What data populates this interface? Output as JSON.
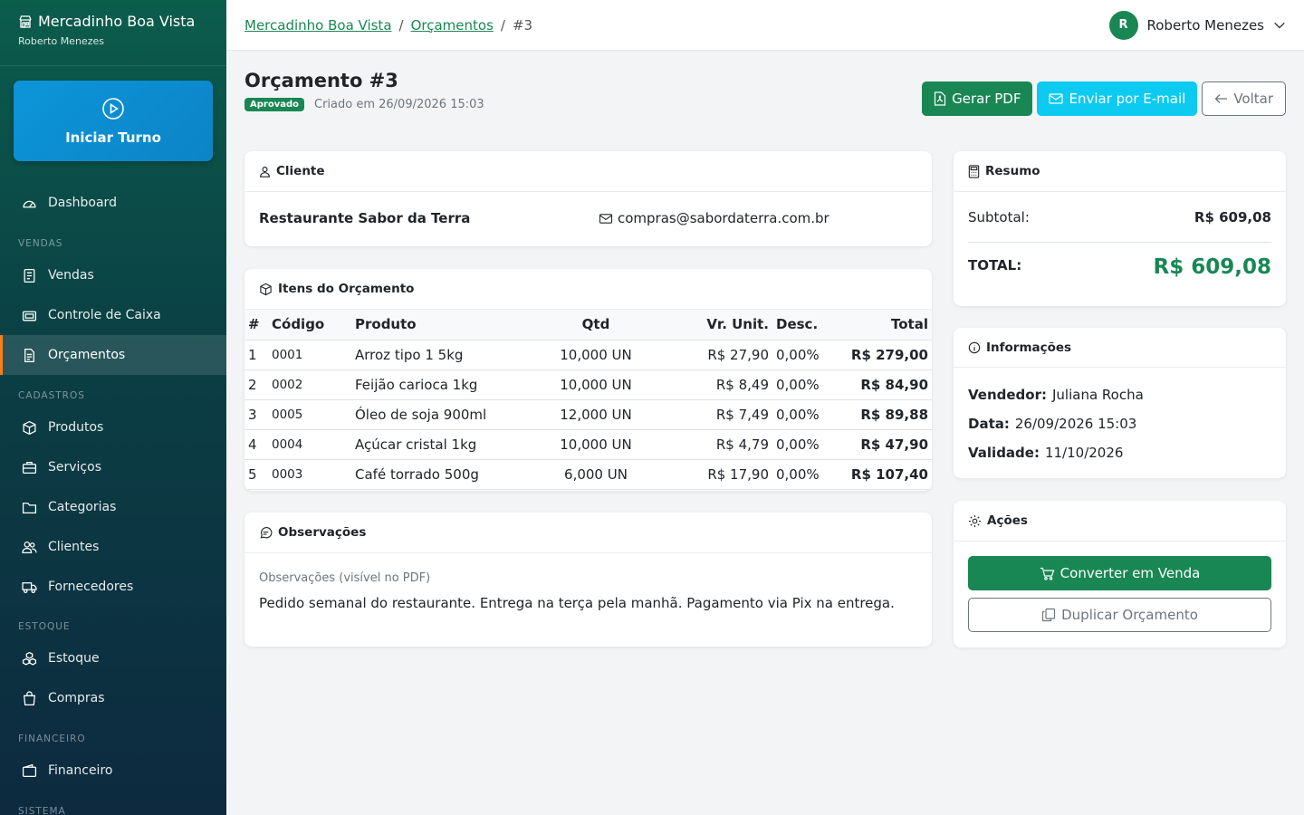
{
  "sidebar": {
    "brand_title": "Mercadinho Boa Vista",
    "brand_user": "Roberto Menezes",
    "shift_button": "Iniciar Turno",
    "dashboard": "Dashboard",
    "sections": {
      "vendas": "VENDAS",
      "cadastros": "CADASTROS",
      "estoque": "ESTOQUE",
      "financeiro": "FINANCEIRO",
      "sistema": "SISTEMA"
    },
    "items": {
      "vendas": "Vendas",
      "caixa": "Controle de Caixa",
      "orcamentos": "Orçamentos",
      "produtos": "Produtos",
      "servicos": "Serviços",
      "categorias": "Categorias",
      "clientes": "Clientes",
      "fornecedores": "Fornecedores",
      "estoque": "Estoque",
      "compras": "Compras",
      "financeiro": "Financeiro"
    }
  },
  "topbar": {
    "breadcrumb": [
      "Mercadinho Boa Vista",
      "Orçamentos",
      "#3"
    ],
    "separator": "/",
    "user_initial": "R",
    "user_name": "Roberto Menezes"
  },
  "header": {
    "title": "Orçamento #3",
    "status": "Aprovado",
    "created": "Criado em 26/09/2026 15:03",
    "buttons": {
      "pdf": "Gerar PDF",
      "email": "Enviar por E-mail",
      "back": "Voltar"
    }
  },
  "client": {
    "title": "Cliente",
    "name": "Restaurante Sabor da Terra",
    "email": "compras@sabordaterra.com.br"
  },
  "items": {
    "title": "Itens do Orçamento",
    "headers": [
      "#",
      "Código",
      "Produto",
      "Qtd",
      "Vr. Unit.",
      "Desc.",
      "Total"
    ],
    "rows": [
      {
        "n": "1",
        "code": "0001",
        "product": "Arroz tipo 1 5kg",
        "qty": "10,000 UN",
        "unit": "R$ 27,90",
        "disc": "0,00%",
        "total": "R$ 279,00"
      },
      {
        "n": "2",
        "code": "0002",
        "product": "Feijão carioca 1kg",
        "qty": "10,000 UN",
        "unit": "R$ 8,49",
        "disc": "0,00%",
        "total": "R$ 84,90"
      },
      {
        "n": "3",
        "code": "0005",
        "product": "Óleo de soja 900ml",
        "qty": "12,000 UN",
        "unit": "R$ 7,49",
        "disc": "0,00%",
        "total": "R$ 89,88"
      },
      {
        "n": "4",
        "code": "0004",
        "product": "Açúcar cristal 1kg",
        "qty": "10,000 UN",
        "unit": "R$ 4,79",
        "disc": "0,00%",
        "total": "R$ 47,90"
      },
      {
        "n": "5",
        "code": "0003",
        "product": "Café torrado 500g",
        "qty": "6,000 UN",
        "unit": "R$ 17,90",
        "disc": "0,00%",
        "total": "R$ 107,40"
      }
    ]
  },
  "observations": {
    "title": "Observações",
    "label": "Observações (visível no PDF)",
    "text": "Pedido semanal do restaurante. Entrega na terça pela manhã. Pagamento via Pix na entrega."
  },
  "summary": {
    "title": "Resumo",
    "subtotal_label": "Subtotal:",
    "subtotal": "R$ 609,08",
    "total_label": "TOTAL:",
    "total": "R$ 609,08"
  },
  "info": {
    "title": "Informações",
    "seller_label": "Vendedor:",
    "seller": "Juliana Rocha",
    "date_label": "Data:",
    "date": "26/09/2026 15:03",
    "validity_label": "Validade:",
    "validity": "11/10/2026"
  },
  "quote_actions": {
    "title": "Ações",
    "convert": "Converter em Venda",
    "duplicate": "Duplicar Orçamento"
  },
  "colors": {
    "primary": "#198754",
    "info": "#0dcaf0",
    "active_marker": "#fd7e14"
  }
}
